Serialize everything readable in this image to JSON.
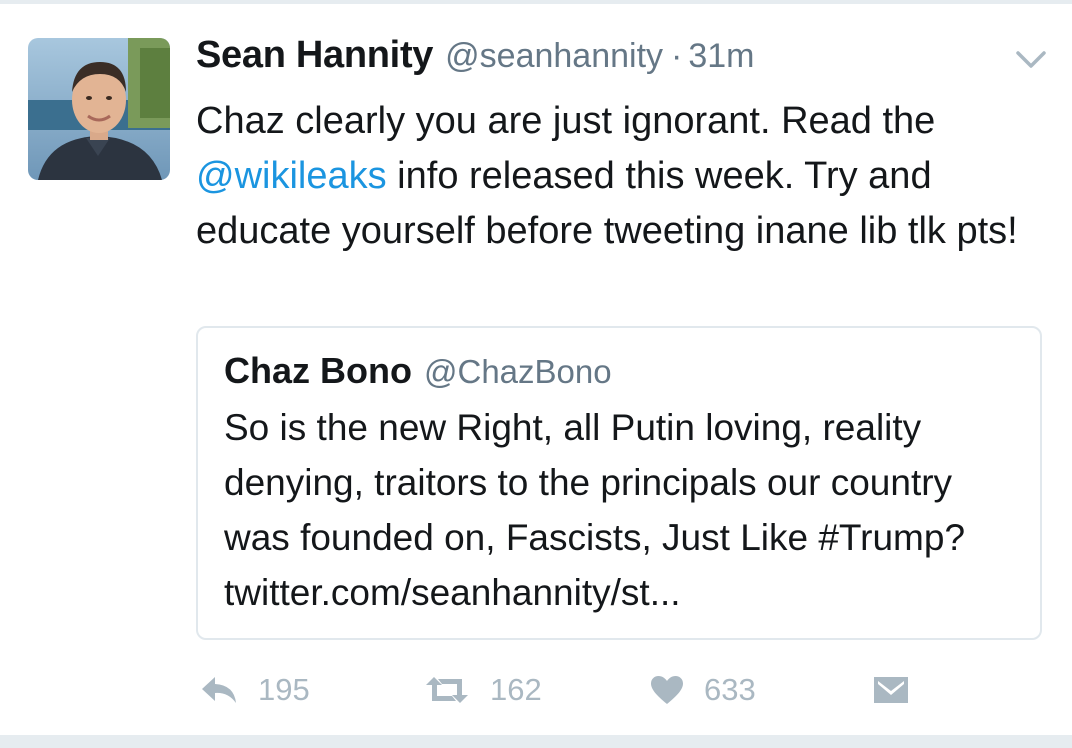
{
  "tweet": {
    "author_name": "Sean Hannity",
    "author_handle": "@seanhannity",
    "separator": "·",
    "time": "31m",
    "text_before": "Chaz clearly you are just ignorant. Read the ",
    "mention": "@wikileaks",
    "text_after": " info released this week. Try and educate yourself before tweeting inane lib tlk pts!"
  },
  "quoted_tweet": {
    "author_name": "Chaz Bono",
    "author_handle": "@ChazBono",
    "text": "So is the new Right, all Putin loving, reality denying, traitors to the principals our country was founded on, Fascists, Just Like #Trump? twitter.com/seanhannity/st..."
  },
  "actions": {
    "reply_count": "195",
    "retweet_count": "162",
    "like_count": "633"
  },
  "icons": {
    "avatar": "profile-photo",
    "caret": "chevron-down-icon",
    "reply": "reply-icon",
    "retweet": "retweet-icon",
    "like": "heart-icon",
    "dm": "envelope-icon"
  },
  "colors": {
    "text": "#14171a",
    "secondary": "#657786",
    "link": "#1b95e0",
    "action": "#aab8c2",
    "border": "#e1e8ed"
  }
}
